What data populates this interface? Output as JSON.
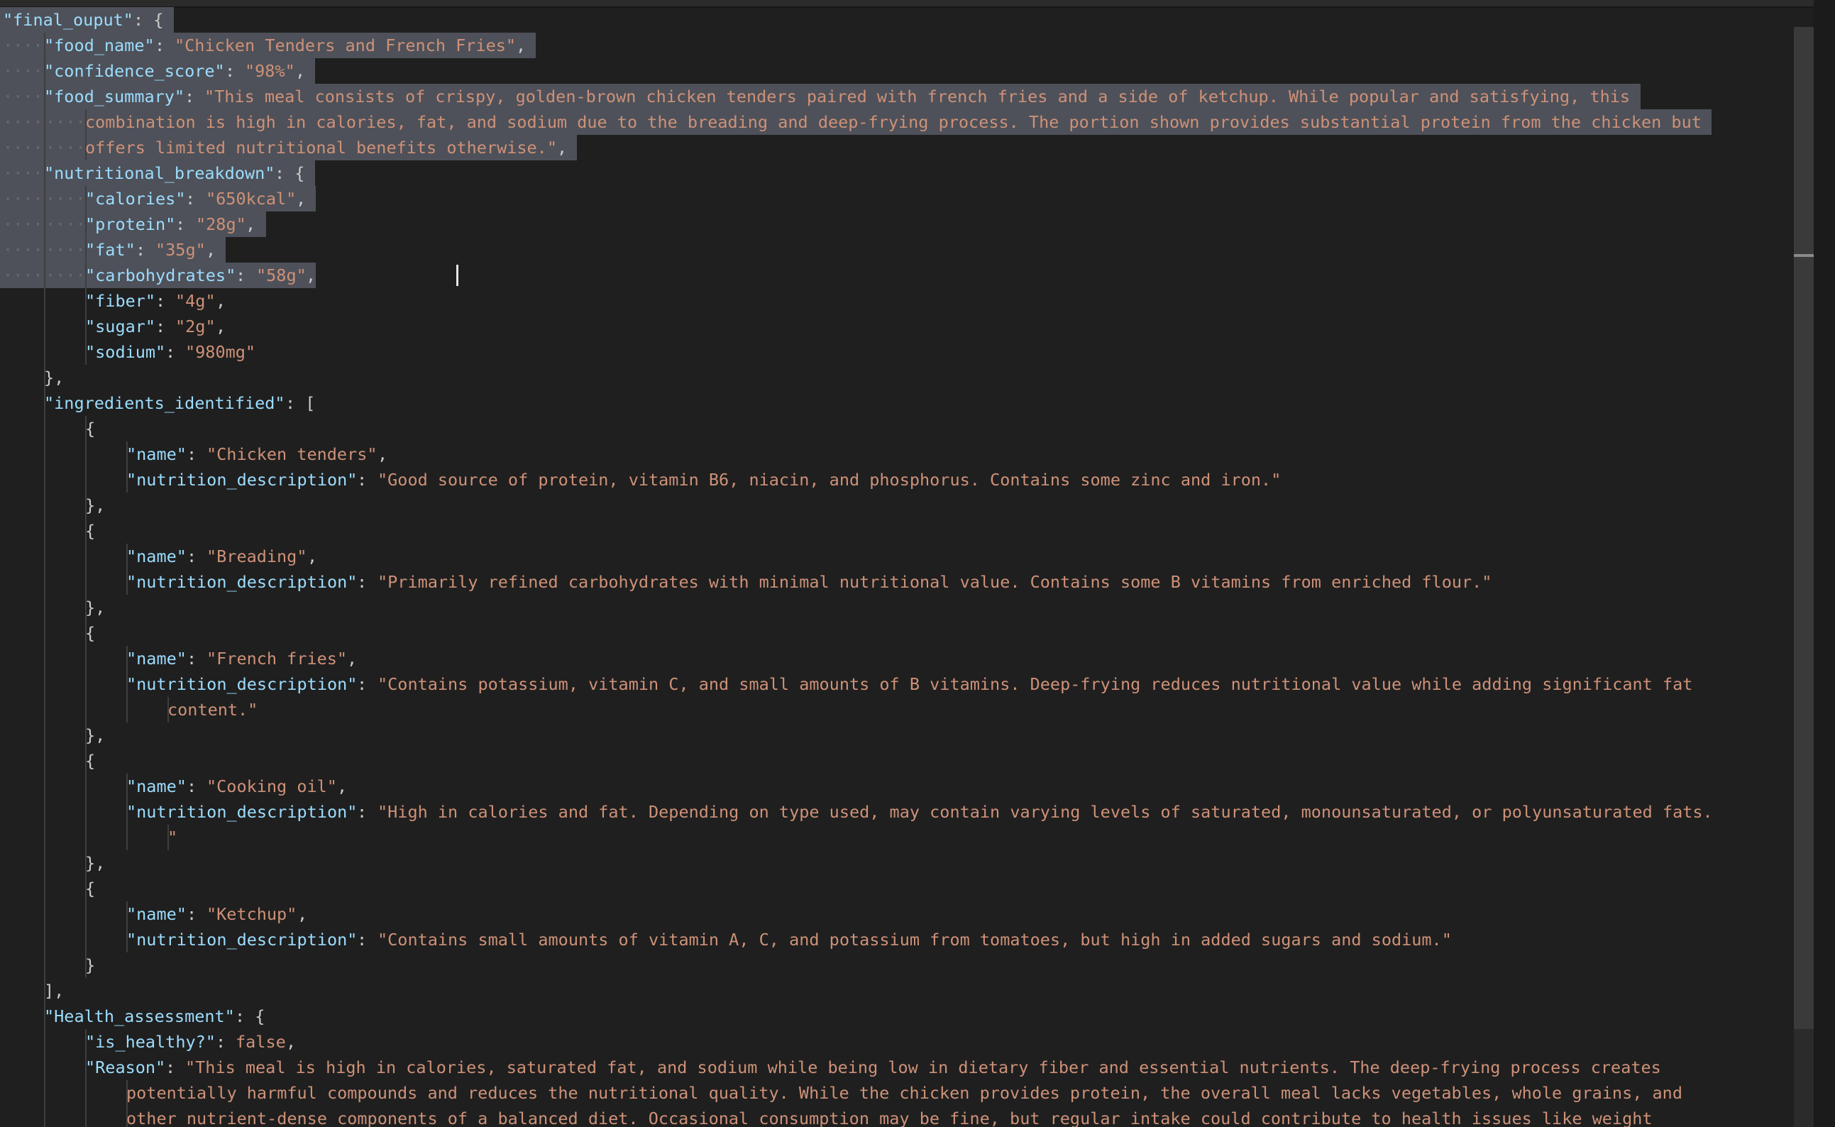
{
  "colors": {
    "background": "#1f1f1f",
    "json_key": "#9cdcfe",
    "json_string": "#ce9178",
    "punctuation": "#cccccc",
    "selection": "#4e5159",
    "indent_guide": "#3e3e3e"
  },
  "editor": {
    "language": "json",
    "selection_rows": 11,
    "cursor": {
      "line": 11,
      "column": 38
    },
    "lines": [
      [
        [
          0,
          "key",
          "\"final_ouput\""
        ],
        [
          0,
          "pun",
          ": {"
        ]
      ],
      [
        [
          1,
          "key",
          "\"food_name\""
        ],
        [
          1,
          "pun",
          ": "
        ],
        [
          1,
          "str",
          "\"Chicken Tenders and French Fries\""
        ],
        [
          1,
          "pun",
          ","
        ]
      ],
      [
        [
          1,
          "key",
          "\"confidence_score\""
        ],
        [
          1,
          "pun",
          ": "
        ],
        [
          1,
          "str",
          "\"98%\""
        ],
        [
          1,
          "pun",
          ","
        ]
      ],
      [
        [
          1,
          "key",
          "\"food_summary\""
        ],
        [
          1,
          "pun",
          ": "
        ],
        [
          1,
          "str",
          "\"This meal consists of crispy, golden-brown chicken tenders paired with french fries and a side of ketchup. While popular and satisfying, this"
        ]
      ],
      [
        [
          2,
          "str",
          "combination is high in calories, fat, and sodium due to the breading and deep-frying process. The portion shown provides substantial protein from the chicken but"
        ]
      ],
      [
        [
          2,
          "str",
          "offers limited nutritional benefits otherwise.\""
        ],
        [
          2,
          "pun",
          ","
        ]
      ],
      [
        [
          1,
          "key",
          "\"nutritional_breakdown\""
        ],
        [
          1,
          "pun",
          ": {"
        ]
      ],
      [
        [
          2,
          "key",
          "\"calories\""
        ],
        [
          2,
          "pun",
          ": "
        ],
        [
          2,
          "str",
          "\"650kcal\""
        ],
        [
          2,
          "pun",
          ","
        ]
      ],
      [
        [
          2,
          "key",
          "\"protein\""
        ],
        [
          2,
          "pun",
          ": "
        ],
        [
          2,
          "str",
          "\"28g\""
        ],
        [
          2,
          "pun",
          ","
        ]
      ],
      [
        [
          2,
          "key",
          "\"fat\""
        ],
        [
          2,
          "pun",
          ": "
        ],
        [
          2,
          "str",
          "\"35g\""
        ],
        [
          2,
          "pun",
          ","
        ]
      ],
      [
        [
          2,
          "key",
          "\"carbohydrates\""
        ],
        [
          2,
          "pun",
          ": "
        ],
        [
          2,
          "str",
          "\"58g\""
        ],
        [
          2,
          "pun",
          ","
        ]
      ],
      [
        [
          2,
          "key",
          "\"fiber\""
        ],
        [
          2,
          "pun",
          ": "
        ],
        [
          2,
          "str",
          "\"4g\""
        ],
        [
          2,
          "pun",
          ","
        ]
      ],
      [
        [
          2,
          "key",
          "\"sugar\""
        ],
        [
          2,
          "pun",
          ": "
        ],
        [
          2,
          "str",
          "\"2g\""
        ],
        [
          2,
          "pun",
          ","
        ]
      ],
      [
        [
          2,
          "key",
          "\"sodium\""
        ],
        [
          2,
          "pun",
          ": "
        ],
        [
          2,
          "str",
          "\"980mg\""
        ]
      ],
      [
        [
          1,
          "pun",
          "},"
        ]
      ],
      [
        [
          1,
          "key",
          "\"ingredients_identified\""
        ],
        [
          1,
          "pun",
          ": ["
        ]
      ],
      [
        [
          2,
          "pun",
          "{"
        ]
      ],
      [
        [
          3,
          "key",
          "\"name\""
        ],
        [
          3,
          "pun",
          ": "
        ],
        [
          3,
          "str",
          "\"Chicken tenders\""
        ],
        [
          3,
          "pun",
          ","
        ]
      ],
      [
        [
          3,
          "key",
          "\"nutrition_description\""
        ],
        [
          3,
          "pun",
          ": "
        ],
        [
          3,
          "str",
          "\"Good source of protein, vitamin B6, niacin, and phosphorus. Contains some zinc and iron.\""
        ]
      ],
      [
        [
          2,
          "pun",
          "},"
        ]
      ],
      [
        [
          2,
          "pun",
          "{"
        ]
      ],
      [
        [
          3,
          "key",
          "\"name\""
        ],
        [
          3,
          "pun",
          ": "
        ],
        [
          3,
          "str",
          "\"Breading\""
        ],
        [
          3,
          "pun",
          ","
        ]
      ],
      [
        [
          3,
          "key",
          "\"nutrition_description\""
        ],
        [
          3,
          "pun",
          ": "
        ],
        [
          3,
          "str",
          "\"Primarily refined carbohydrates with minimal nutritional value. Contains some B vitamins from enriched flour.\""
        ]
      ],
      [
        [
          2,
          "pun",
          "},"
        ]
      ],
      [
        [
          2,
          "pun",
          "{"
        ]
      ],
      [
        [
          3,
          "key",
          "\"name\""
        ],
        [
          3,
          "pun",
          ": "
        ],
        [
          3,
          "str",
          "\"French fries\""
        ],
        [
          3,
          "pun",
          ","
        ]
      ],
      [
        [
          3,
          "key",
          "\"nutrition_description\""
        ],
        [
          3,
          "pun",
          ": "
        ],
        [
          3,
          "str",
          "\"Contains potassium, vitamin C, and small amounts of B vitamins. Deep-frying reduces nutritional value while adding significant fat"
        ]
      ],
      [
        [
          4,
          "str",
          "content.\""
        ]
      ],
      [
        [
          2,
          "pun",
          "},"
        ]
      ],
      [
        [
          2,
          "pun",
          "{"
        ]
      ],
      [
        [
          3,
          "key",
          "\"name\""
        ],
        [
          3,
          "pun",
          ": "
        ],
        [
          3,
          "str",
          "\"Cooking oil\""
        ],
        [
          3,
          "pun",
          ","
        ]
      ],
      [
        [
          3,
          "key",
          "\"nutrition_description\""
        ],
        [
          3,
          "pun",
          ": "
        ],
        [
          3,
          "str",
          "\"High in calories and fat. Depending on type used, may contain varying levels of saturated, monounsaturated, or polyunsaturated fats."
        ]
      ],
      [
        [
          4,
          "str",
          "\""
        ]
      ],
      [
        [
          2,
          "pun",
          "},"
        ]
      ],
      [
        [
          2,
          "pun",
          "{"
        ]
      ],
      [
        [
          3,
          "key",
          "\"name\""
        ],
        [
          3,
          "pun",
          ": "
        ],
        [
          3,
          "str",
          "\"Ketchup\""
        ],
        [
          3,
          "pun",
          ","
        ]
      ],
      [
        [
          3,
          "key",
          "\"nutrition_description\""
        ],
        [
          3,
          "pun",
          ": "
        ],
        [
          3,
          "str",
          "\"Contains small amounts of vitamin A, C, and potassium from tomatoes, but high in added sugars and sodium.\""
        ]
      ],
      [
        [
          2,
          "pun",
          "}"
        ]
      ],
      [
        [
          1,
          "pun",
          "],"
        ]
      ],
      [
        [
          1,
          "key",
          "\"Health_assessment\""
        ],
        [
          1,
          "pun",
          ": {"
        ]
      ],
      [
        [
          2,
          "key",
          "\"is_healthy?\""
        ],
        [
          2,
          "pun",
          ": "
        ],
        [
          2,
          "kw",
          "false"
        ],
        [
          2,
          "pun",
          ","
        ]
      ],
      [
        [
          2,
          "key",
          "\"Reason\""
        ],
        [
          2,
          "pun",
          ": "
        ],
        [
          2,
          "str",
          "\"This meal is high in calories, saturated fat, and sodium while being low in dietary fiber and essential nutrients. The deep-frying process creates"
        ]
      ],
      [
        [
          3,
          "str",
          "potentially harmful compounds and reduces the nutritional quality. While the chicken provides protein, the overall meal lacks vegetables, whole grains, and"
        ]
      ],
      [
        [
          3,
          "str",
          "other nutrient-dense components of a balanced diet. Occasional consumption may be fine, but regular intake could contribute to health issues like weight"
        ]
      ]
    ]
  }
}
